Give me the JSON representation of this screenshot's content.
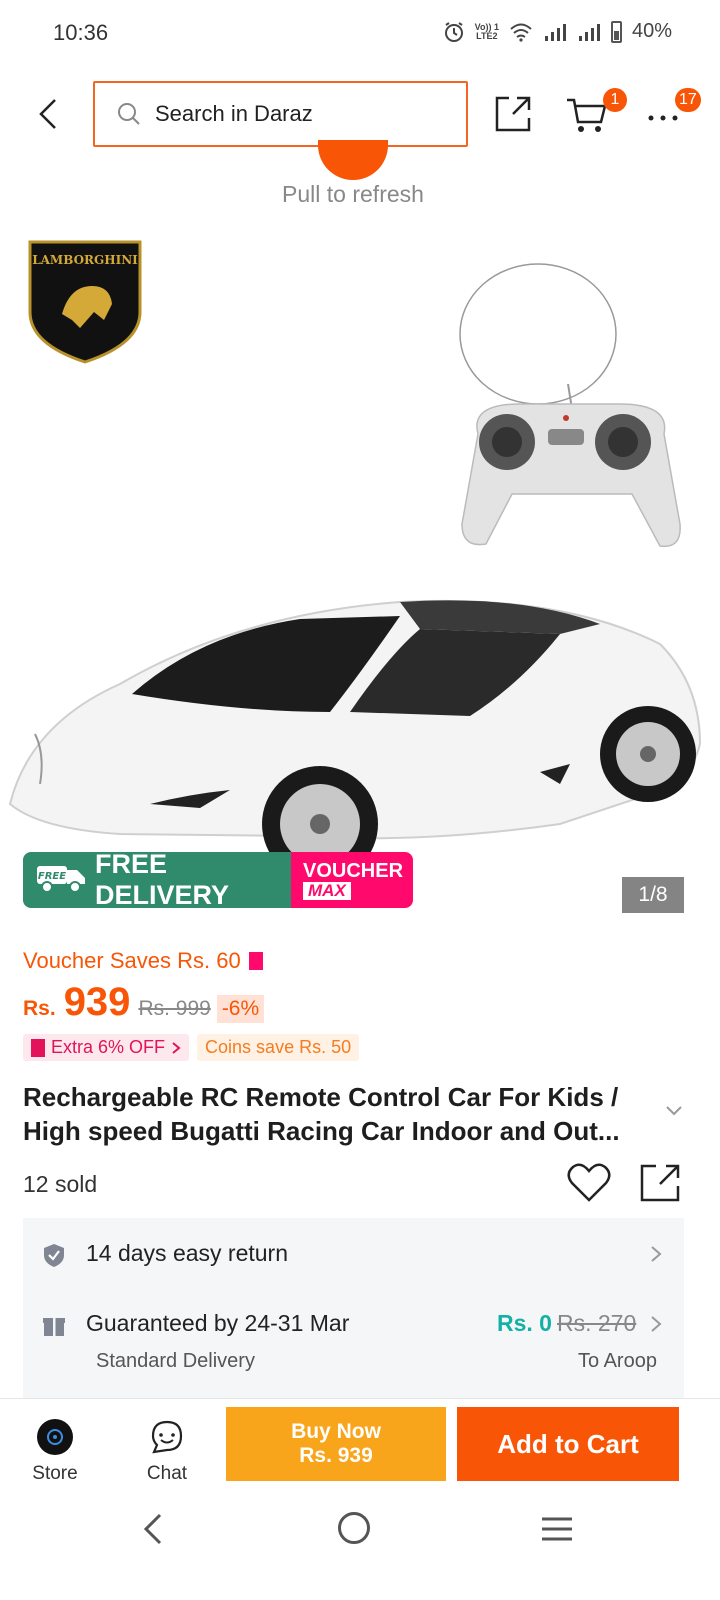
{
  "status_bar": {
    "time": "10:36",
    "network_label_top": "Vo)) 1",
    "network_label_bottom": "LTE2",
    "battery": "40%"
  },
  "header": {
    "search_placeholder": "Search in Daraz",
    "cart_badge": "1",
    "more_badge": "17"
  },
  "refresh": {
    "text": "Pull to refresh"
  },
  "gallery": {
    "counter": "1/8",
    "brand_logo_text": "LAMBORGHINI",
    "delivery_banner": {
      "free_badge": "FREE",
      "free_text": "FREE DELIVERY",
      "voucher_line1": "VOUCHER",
      "voucher_line2": "MAX"
    }
  },
  "pricing": {
    "voucher_saves": "Voucher Saves Rs. 60",
    "currency": "Rs.",
    "price": "939",
    "old_price": "Rs. 999",
    "discount": "-6%",
    "extra_tag": "Extra 6% OFF",
    "coins_tag": "Coins save Rs. 50"
  },
  "product": {
    "title_line1": "Rechargeable RC Remote Control Car For Kids /",
    "title_line2": "High speed Bugatti Racing Car Indoor and Out...",
    "sold": "12 sold"
  },
  "services": {
    "return_text": "14 days easy return",
    "delivery_text": "Guaranteed by 24-31 Mar",
    "delivery_sub": "Standard Delivery",
    "delivery_price": "Rs. 0",
    "delivery_old_price": "Rs. 270",
    "delivery_to": "To Aroop"
  },
  "actions": {
    "store_label": "Store",
    "chat_label": "Chat",
    "buy_now_line1": "Buy Now",
    "buy_now_line2": "Rs. 939",
    "add_to_cart": "Add to Cart"
  },
  "colors": {
    "brand_orange": "#f85606",
    "buy_now_yellow": "#f8a51b",
    "free_delivery_green": "#2f8b6c",
    "voucher_pink": "#ff0a6c",
    "free_shipping_teal": "#13b1a5"
  }
}
